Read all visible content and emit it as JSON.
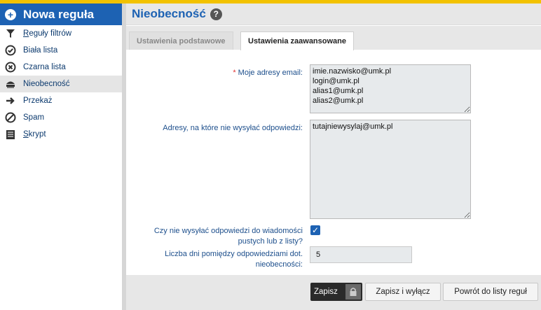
{
  "sidebar": {
    "title": "Nowa reguła",
    "items": [
      {
        "label": "Reguły filtrów",
        "underline": "R",
        "rest": "eguły filtrów",
        "icon": "funnel-icon"
      },
      {
        "label": "Biała lista",
        "underline": "",
        "rest": "Biała lista",
        "icon": "check-circle-icon"
      },
      {
        "label": "Czarna lista",
        "underline": "",
        "rest": "Czarna lista",
        "icon": "x-circle-icon"
      },
      {
        "label": "Nieobecność",
        "underline": "",
        "rest": "Nieobecność",
        "icon": "away-icon"
      },
      {
        "label": "Przekaż",
        "underline": "",
        "rest": "Przekaż",
        "icon": "arrow-right-icon"
      },
      {
        "label": "Spam",
        "underline": "",
        "rest": "Spam",
        "icon": "block-icon"
      },
      {
        "label": "Skrypt",
        "underline": "S",
        "rest": "krypt",
        "icon": "script-icon"
      }
    ]
  },
  "main": {
    "title": "Nieobecność",
    "tabs": [
      {
        "label": "Ustawienia podstawowe"
      },
      {
        "label": "Ustawienia zaawansowane"
      }
    ],
    "form": {
      "emails_required": "*",
      "emails_label": "Moje adresy email:",
      "emails_value": "imie.nazwisko@umk.pl\nlogin@umk.pl\nalias1@umk.pl\nalias2@umk.pl",
      "noreply_label": "Adresy, na które nie wysyłać odpowiedzi:",
      "noreply_value": "tutajniewysylaj@umk.pl",
      "empty_subject_label_1": "Czy nie wysyłać odpowiedzi do wiadomości",
      "empty_subject_label_2": "pustych lub z listy?",
      "empty_subject_checked": true,
      "days_label_1": "Liczba dni pomiędzy odpowiedziami dot.",
      "days_label_2": "nieobecności:",
      "days_value": "5"
    },
    "buttons": {
      "save": "Zapisz",
      "save_disable": "Zapisz i wyłącz",
      "back": "Powrót do listy reguł"
    }
  }
}
